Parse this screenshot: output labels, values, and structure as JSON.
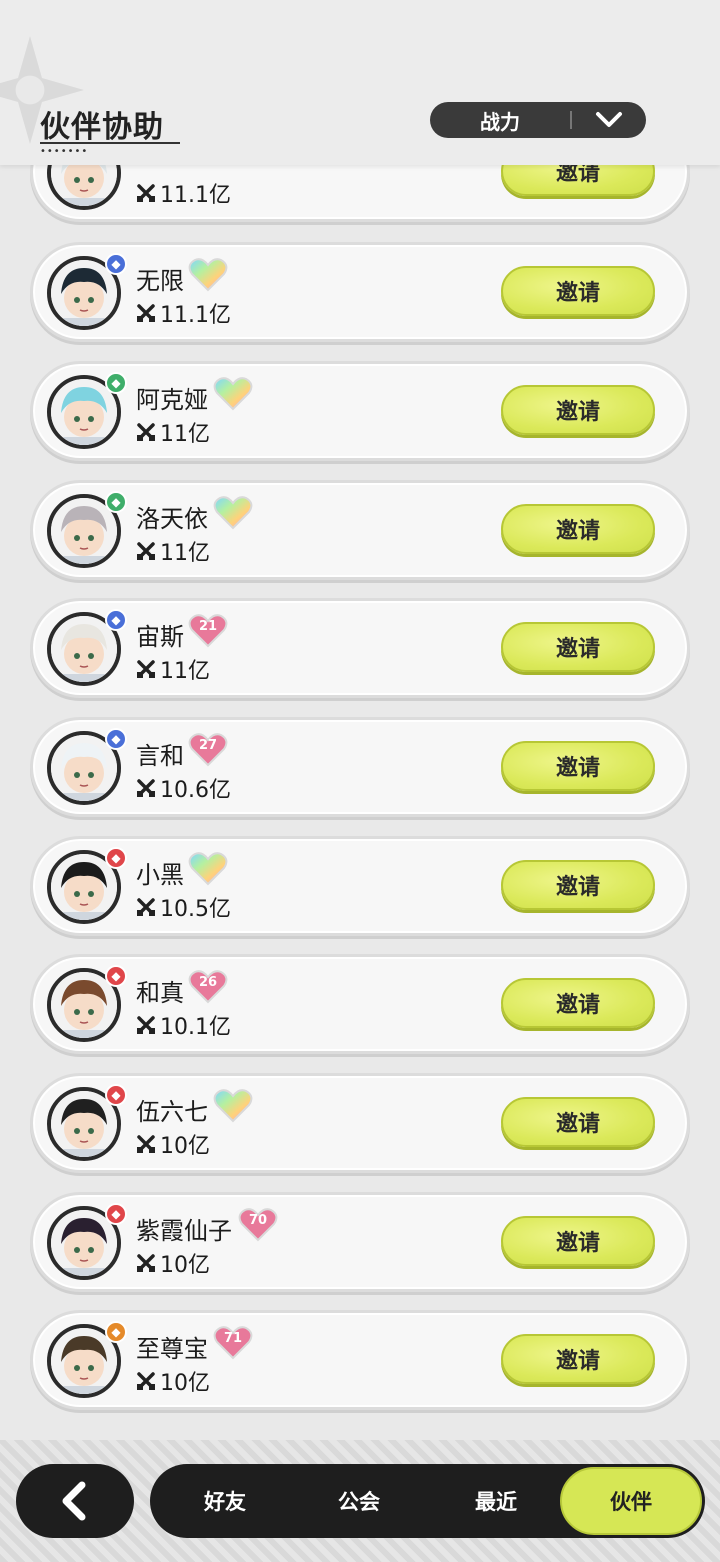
{
  "header": {
    "title": "伙伴协助",
    "sort": {
      "selected": "战力",
      "icon": "chevron-down-icon"
    }
  },
  "power_icon": "crossed-swords-icon",
  "invite_label": "邀请",
  "partners": [
    {
      "name": "",
      "power": "11.1亿",
      "heart": null,
      "element": "blue",
      "partial": true
    },
    {
      "name": "无限",
      "power": "11.1亿",
      "heart": "rainbow",
      "element": "blue"
    },
    {
      "name": "阿克娅",
      "power": "11亿",
      "heart": "rainbow",
      "element": "green"
    },
    {
      "name": "洛天依",
      "power": "11亿",
      "heart": "rainbow",
      "element": "green"
    },
    {
      "name": "宙斯",
      "power": "11亿",
      "heart": "21",
      "element": "blue"
    },
    {
      "name": "言和",
      "power": "10.6亿",
      "heart": "27",
      "element": "blue"
    },
    {
      "name": "小黑",
      "power": "10.5亿",
      "heart": "rainbow",
      "element": "red"
    },
    {
      "name": "和真",
      "power": "10.1亿",
      "heart": "26",
      "element": "red"
    },
    {
      "name": "伍六七",
      "power": "10亿",
      "heart": "rainbow",
      "element": "red"
    },
    {
      "name": "紫霞仙子",
      "power": "10亿",
      "heart": "70",
      "element": "red"
    },
    {
      "name": "至尊宝",
      "power": "10亿",
      "heart": "71",
      "element": "orange"
    }
  ],
  "colors": {
    "accent": "#d6e755",
    "element_blue": "#4a6fd8",
    "element_green": "#3fae6a",
    "element_red": "#e0464a",
    "element_orange": "#e58a2a",
    "heart_pink": "#e8799a"
  },
  "nav": {
    "back_icon": "chevron-left-icon",
    "tabs": [
      "好友",
      "公会",
      "最近",
      "伙伴"
    ],
    "active_tab": "伙伴"
  }
}
